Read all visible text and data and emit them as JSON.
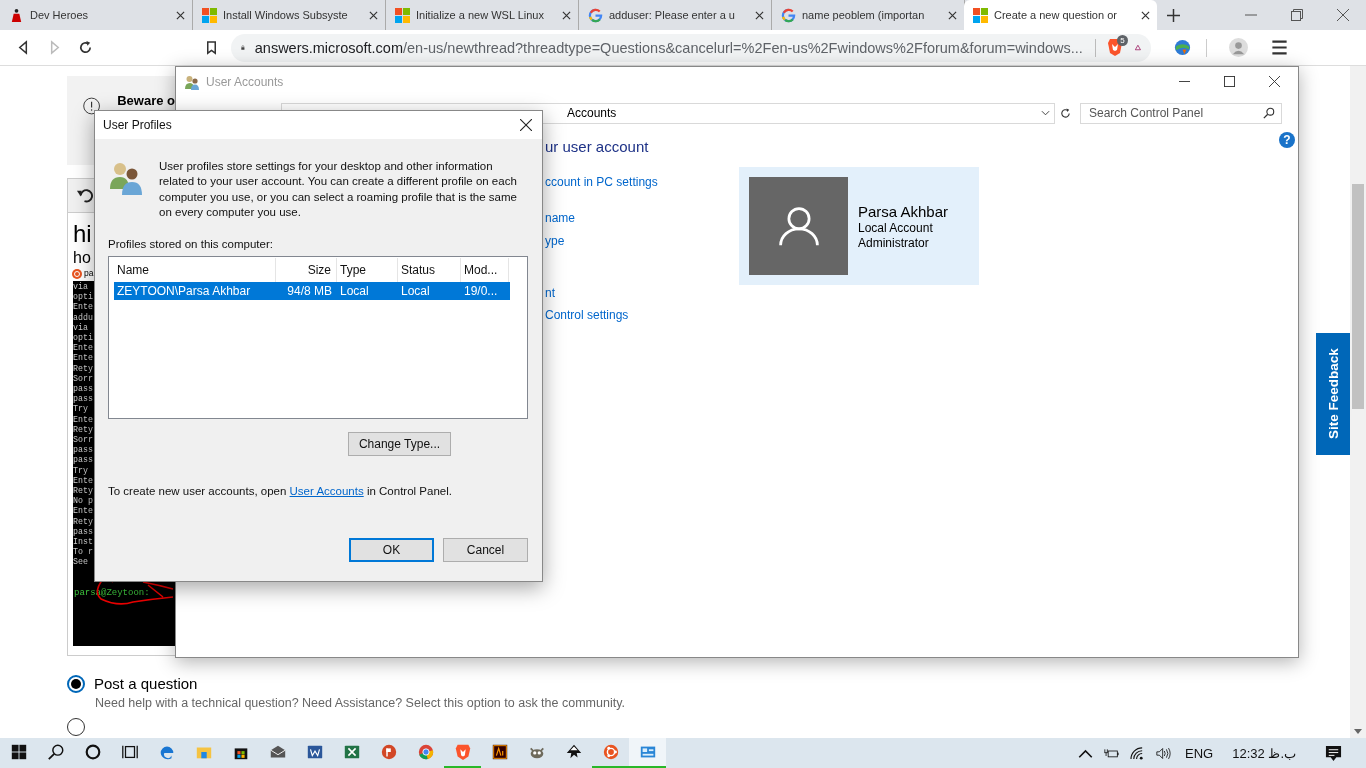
{
  "browser": {
    "tabs": [
      {
        "title": "Dev Heroes",
        "kind": "hero",
        "selected": false
      },
      {
        "title": "Install Windows Subsyste",
        "kind": "windows",
        "selected": false
      },
      {
        "title": "Initialize a new WSL Linux",
        "kind": "windows",
        "selected": false
      },
      {
        "title": "adduser: Please enter a u",
        "kind": "google",
        "selected": false
      },
      {
        "title": "name peoblem (importan",
        "kind": "google",
        "selected": false
      },
      {
        "title": "Create a new question or",
        "kind": "windows",
        "selected": true
      }
    ],
    "url_host": "answers.microsoft.com",
    "url_path": "/en-us/newthread?threadtype=Questions&cancelurl=%2Fen-us%2Fwindows%2Fforum&forum=windows...",
    "shield_count": "5"
  },
  "page": {
    "warning_title": "Beware o",
    "post_title": "hi",
    "post_subtitle": "ho",
    "author": "pa",
    "terminal_lines": [
      "via",
      "opti",
      "Ente",
      "addu",
      "via",
      "opti",
      "Ente",
      "Ente",
      "Rety",
      "Sorr",
      "pass",
      "pass",
      "Try",
      "Ente",
      "Rety",
      "Sorr",
      "pass",
      "pass",
      "Try",
      "Ente",
      "Rety",
      "No p",
      "Ente",
      "Rety",
      "pass",
      "Inst",
      "To r",
      "See"
    ],
    "prompt": "parsa@Zeytoon:",
    "options": [
      {
        "label": "Post a question",
        "description": "Need help with a technical question? Need Assistance? Select this option to ask the community.",
        "selected": true
      },
      {
        "selected": false
      }
    ],
    "feedback": "Site Feedback"
  },
  "user_accounts": {
    "title": "User Accounts",
    "breadcrumb": "Accounts",
    "search": {
      "placeholder": "Search Control Panel"
    },
    "help": "?",
    "heading": "ur user account",
    "links": [
      "ccount in PC settings",
      "name",
      "ype",
      "nt",
      "Control settings"
    ],
    "account": {
      "name": "Parsa Akhbar",
      "type": "Local Account",
      "role": "Administrator"
    }
  },
  "dialog": {
    "title": "User Profiles",
    "description": "User profiles store settings for your desktop and other information related to your user account. You can create a different profile on each computer you use, or you can select a roaming profile that is the same on every computer you use.",
    "list_label": "Profiles stored on this computer:",
    "columns": [
      "Name",
      "Size",
      "Type",
      "Status",
      "Mod..."
    ],
    "rows": [
      {
        "cells": [
          "ZEYTOON\\Parsa Akhbar",
          "94/8 MB",
          "Local",
          "Local",
          "19/0..."
        ],
        "selected": true
      }
    ],
    "change_button": "Change Type...",
    "footer_before": "To create new user accounts, open",
    "footer_link": "User Accounts",
    "footer_after": "in Control Panel.",
    "buttons": [
      {
        "label": "OK",
        "kind": "default"
      },
      {
        "label": "Cancel",
        "kind": "normal"
      }
    ]
  },
  "taskbar": {
    "apps": [
      {
        "kind": "start",
        "running": false,
        "active": false
      },
      {
        "kind": "search",
        "running": false,
        "active": false
      },
      {
        "kind": "cortana",
        "running": false,
        "active": false
      },
      {
        "kind": "taskview",
        "running": false,
        "active": false
      },
      {
        "kind": "edge",
        "running": false,
        "active": false
      },
      {
        "kind": "explorer",
        "running": false,
        "active": false
      },
      {
        "kind": "store",
        "running": false,
        "active": false
      },
      {
        "kind": "mail",
        "running": false,
        "active": false
      },
      {
        "kind": "word",
        "running": false,
        "active": false
      },
      {
        "kind": "excel",
        "running": false,
        "active": false
      },
      {
        "kind": "powerpoint",
        "running": false,
        "active": false
      },
      {
        "kind": "chrome",
        "running": false,
        "active": false
      },
      {
        "kind": "brave",
        "running": true,
        "active": false
      },
      {
        "kind": "illustrator",
        "running": false,
        "active": false
      },
      {
        "kind": "gimp",
        "running": false,
        "active": false
      },
      {
        "kind": "inkscape",
        "running": false,
        "active": false
      },
      {
        "kind": "ubuntu",
        "running": true,
        "active": false
      },
      {
        "kind": "controlpanel",
        "running": true,
        "active": true
      }
    ],
    "lang": "ENG",
    "clock": "12:32 ب.ظ"
  }
}
